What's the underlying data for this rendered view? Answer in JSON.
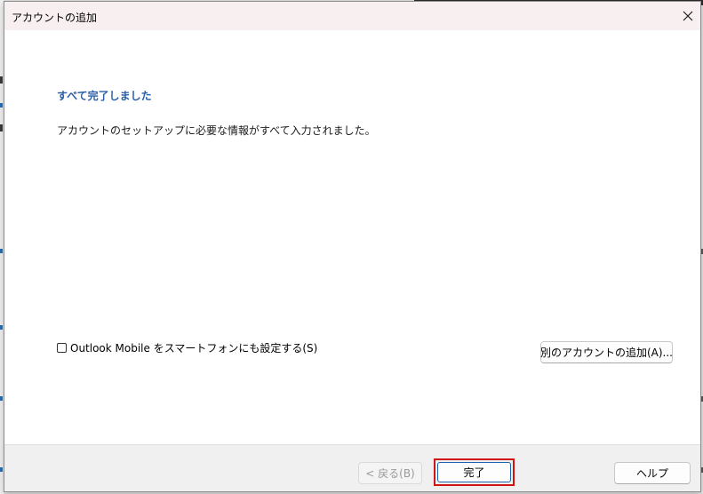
{
  "window": {
    "title": "アカウントの追加"
  },
  "content": {
    "heading": "すべて完了しました",
    "message": "アカウントのセットアップに必要な情報がすべて入力されました。",
    "mobile_checkbox": {
      "label": "Outlook Mobile をスマートフォンにも設定する(S)",
      "checked": false
    },
    "add_account_label": "別のアカウントの追加(A)..."
  },
  "footer": {
    "back_label": "< 戻る(B)",
    "finish_label": "完了",
    "help_label": "ヘルプ"
  },
  "colors": {
    "heading": "#2a5fa8",
    "titlebar": "#f8eff1",
    "highlight": "#d01414",
    "default_button_border": "#1d64b0"
  },
  "icons": {
    "close": "close-icon"
  }
}
